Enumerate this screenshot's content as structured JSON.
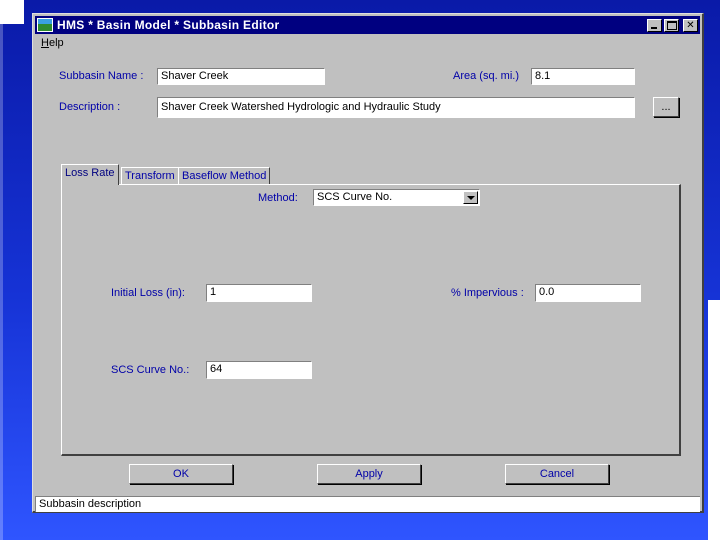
{
  "window": {
    "title": "HMS * Basin Model * Subbasin Editor"
  },
  "menu": {
    "help": "Help"
  },
  "subbasin": {
    "name_label": "Subbasin Name :",
    "name_value": "Shaver Creek",
    "area_label": "Area (sq. mi.)",
    "area_value": "8.1",
    "description_label": "Description :",
    "description_value": "Shaver Creek Watershed Hydrologic and Hydraulic Study",
    "browse_label": "..."
  },
  "tabs": [
    {
      "label": "Loss Rate",
      "active": true
    },
    {
      "label": "Transform",
      "active": false
    },
    {
      "label": "Baseflow Method",
      "active": false
    }
  ],
  "loss_rate": {
    "method_label": "Method:",
    "method_value": "SCS Curve No.",
    "initial_loss_label": "Initial Loss (in):",
    "initial_loss_value": "1",
    "impervious_label": "% Impervious :",
    "impervious_value": "0.0",
    "curve_no_label": "SCS Curve No.:",
    "curve_no_value": "64"
  },
  "buttons": {
    "ok": "OK",
    "apply": "Apply",
    "cancel": "Cancel"
  },
  "status": {
    "text": "Subbasin description"
  },
  "colors": {
    "background_top": "#0a1aa8",
    "titlebar": "#000080",
    "label_text": "#0000a8",
    "window_face": "#c0c0c0"
  }
}
